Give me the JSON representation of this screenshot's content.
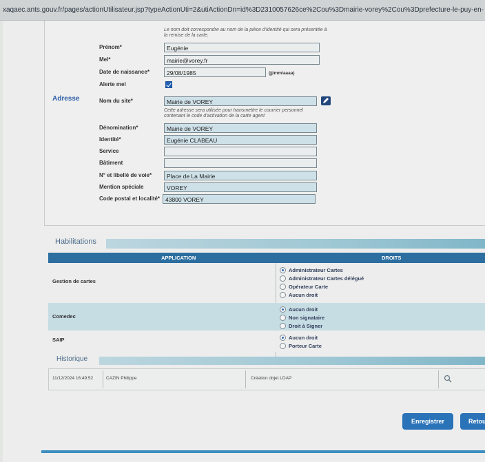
{
  "browser": {
    "url": "xaqaec.ants.gouv.fr/pages/actionUtilisateur.jsp?typeActionUti=2&utiActionDn=id%3D2310057626ce%2Cou%3Dmairie-vorey%2Cou%3Dprefecture-le-puy-en-"
  },
  "identity": {
    "note": "Le nom doit correspondre au nom de la pièce d'identité qui sera présentée à la remise de la carte.",
    "prenom_label": "Prénom*",
    "prenom_value": "Eugénie",
    "mel_label": "Mel*",
    "mel_value": "mairie@vorey.fr",
    "birth_label": "Date de naissance*",
    "birth_value": "29/08/1985",
    "birth_hint": "(jj/mm/aaaa)",
    "alert_label": "Alerte mel"
  },
  "address": {
    "section_label": "Adresse",
    "site_label": "Nom du site*",
    "site_value": "Mairie de VOREY",
    "site_note": "Cette adresse sera utilisée pour transmettre le courrier personnel contenant le code d'activation de la carte agent",
    "denom_label": "Dénomination*",
    "denom_value": "Mairie de VOREY",
    "identite_label": "Identité*",
    "identite_value": "Eugénie CLABEAU",
    "service_label": "Service",
    "service_value": "",
    "batiment_label": "Bâtiment",
    "batiment_value": "",
    "voie_label": "N° et libellé de voie*",
    "voie_value": "Place de La Mairie",
    "mention_label": "Mention spéciale",
    "mention_value": "VOREY",
    "cp_label": "Code postal et localité*",
    "cp_value": "43800 VOREY"
  },
  "habilitations": {
    "title": "Habilitations",
    "col_application": "APPLICATION",
    "col_droits": "DROITS",
    "rows": [
      {
        "app": "Gestion de cartes",
        "options": [
          "Administrateur Cartes",
          "Administrateur Cartes délégué",
          "Opérateur Carte",
          "Aucun droit"
        ],
        "selected": 0
      },
      {
        "app": "Comedec",
        "options": [
          "Aucun droit",
          "Non signataire",
          "Droit à Signer"
        ],
        "selected": 0
      },
      {
        "app": "SAIP",
        "options": [
          "Aucun droit",
          "Porteur Carte"
        ],
        "selected": 0
      }
    ]
  },
  "historique": {
    "title": "Historique",
    "date": "11/12/2024 16:49:52",
    "user": "CAZIN Philippe",
    "action": "Création objet LDAP"
  },
  "actions": {
    "save": "Enregistrer",
    "back": "Retour"
  },
  "colors": {
    "accent": "#2a73b8",
    "header": "#2c6ea0",
    "band": "#9ec7d4"
  }
}
